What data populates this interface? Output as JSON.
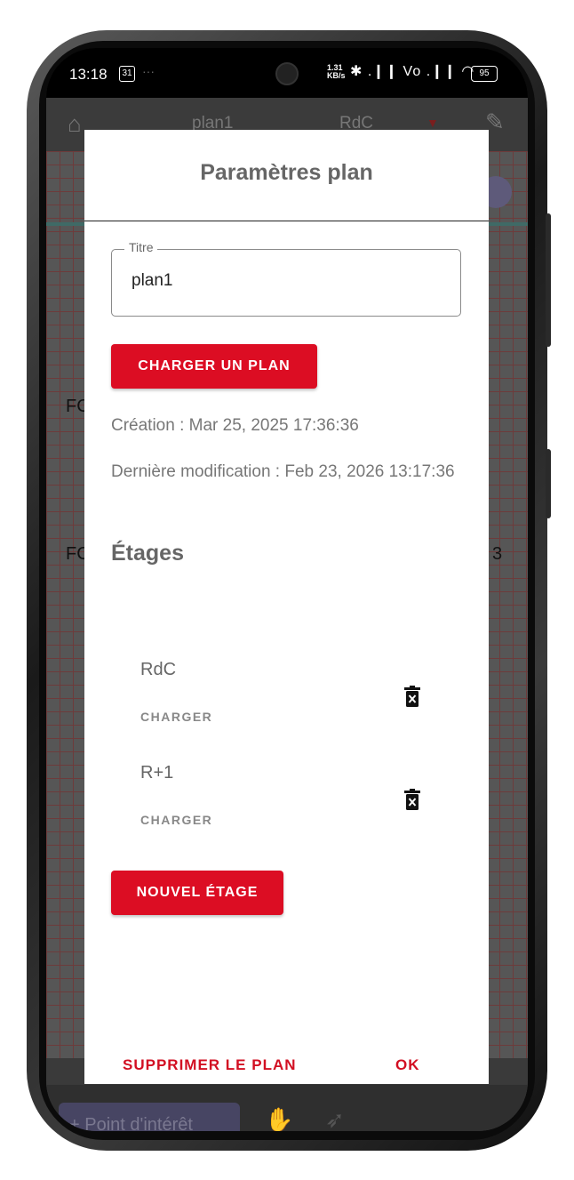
{
  "status_bar": {
    "time": "13:18",
    "calendar_day": "31",
    "net_speed_top": "1.31",
    "net_speed_unit": "KB/s",
    "signal": "✱ .❙❙ Vo .❙❙ ◠",
    "battery": "95"
  },
  "background_app": {
    "plan_name": "plan1",
    "floor_name": "RdC",
    "left_label_1": "FC",
    "left_label_2": "FC",
    "right_label": "3",
    "poi_button": "+ Point d'intérêt"
  },
  "dialog": {
    "title": "Paramètres plan",
    "title_field": {
      "label": "Titre",
      "value": "plan1"
    },
    "load_plan_button": "CHARGER UN PLAN",
    "creation": "Création : Mar 25, 2025 17:36:36",
    "last_modified": "Dernière modification : Feb 23, 2026 13:17:36",
    "floors_heading": "Étages",
    "floors": [
      {
        "name": "RdC",
        "load_label": "CHARGER",
        "delete_icon": "trash-x-icon"
      },
      {
        "name": "R+1",
        "load_label": "CHARGER",
        "delete_icon": "trash-x-icon"
      }
    ],
    "new_floor_button": "NOUVEL ÉTAGE",
    "delete_plan_button": "SUPPRIMER LE PLAN",
    "ok_button": "OK"
  },
  "colors": {
    "accent_red": "#dc0d23",
    "text_gray": "#666666"
  }
}
